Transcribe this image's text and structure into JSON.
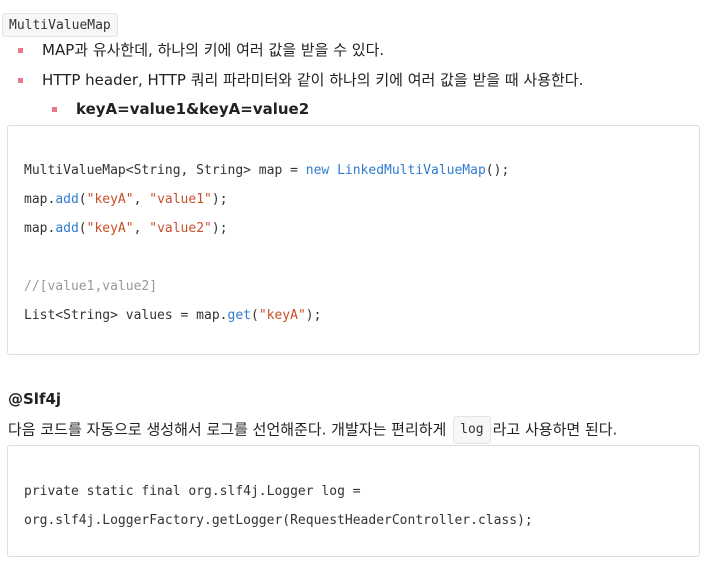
{
  "title_chip": "MultiValueMap",
  "bullets": [
    {
      "text": "MAP과 유사한데, 하나의 키에 여러 값을 받을 수 있다."
    },
    {
      "text": "HTTP header, HTTP 쿼리 파라미터와 같이 하나의 키에 여러 값을 받을 때 사용한다."
    },
    {
      "text": "keyA=value1&keyA=value2"
    }
  ],
  "code1": {
    "l1_a": "MultiValueMap<String, String> map = ",
    "l1_new": "new",
    "l1_space": " ",
    "l1_cls": "LinkedMultiValueMap",
    "l1_end": "();",
    "l2_a": "map.",
    "l2_m": "add",
    "l2_p": "(",
    "l2_s1": "\"keyA\"",
    "l2_c": ", ",
    "l2_s2": "\"value1\"",
    "l2_e": ");",
    "l3_a": "map.",
    "l3_m": "add",
    "l3_p": "(",
    "l3_s1": "\"keyA\"",
    "l3_c": ", ",
    "l3_s2": "\"value2\"",
    "l3_e": ");",
    "l4_comment": "//[value1,value2]",
    "l5_a": "List<String> values = map.",
    "l5_m": "get",
    "l5_p": "(",
    "l5_s": "\"keyA\"",
    "l5_e": ");"
  },
  "section": {
    "heading": "@Slf4j",
    "para_before": "다음 코드를 자동으로 생성해서 로그를 선언해준다. 개발자는 편리하게 ",
    "para_code": "log",
    "para_after": "라고 사용하면 된다."
  },
  "code2": {
    "l1": "private static final org.slf4j.Logger log =",
    "l2": "org.slf4j.LoggerFactory.getLogger(RequestHeaderController.class);"
  },
  "colors": {
    "bullet_marker": "#e8798a",
    "keyword_blue": "#2f7ccf",
    "string_red": "#c8502a",
    "comment_gray": "#999999"
  }
}
